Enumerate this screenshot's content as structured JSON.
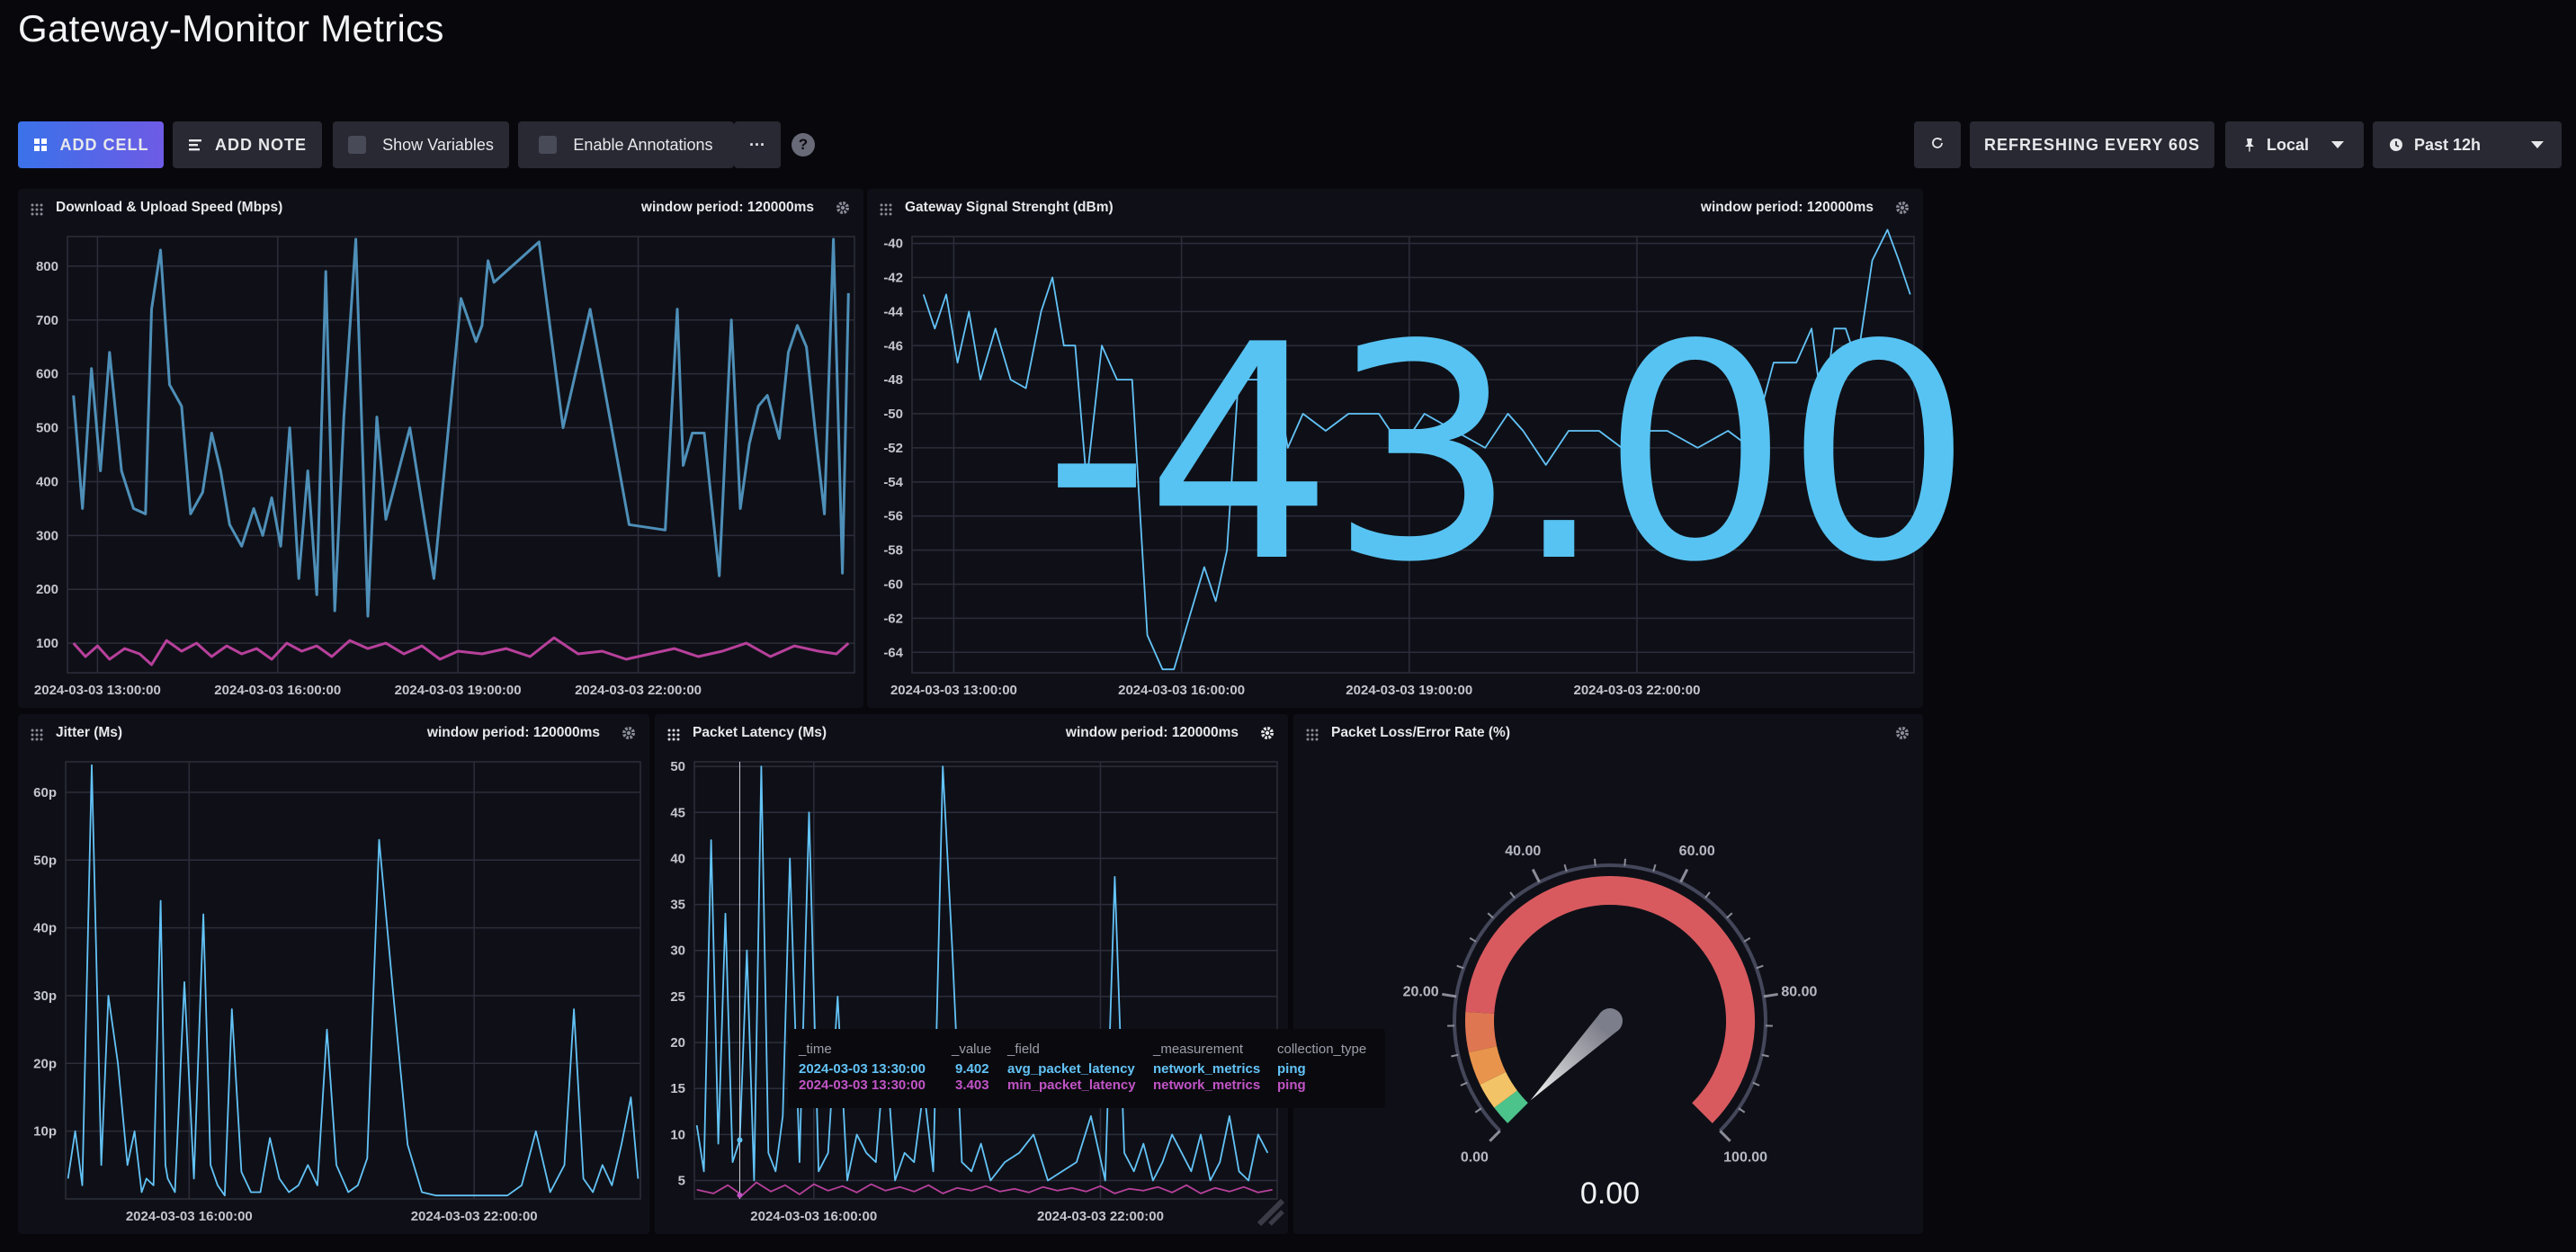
{
  "page_title": "Gateway-Monitor Metrics",
  "toolbar": {
    "add_cell": "ADD CELL",
    "add_note": "ADD NOTE",
    "show_variables": "Show Variables",
    "enable_annotations": "Enable Annotations",
    "more": "···",
    "help": "?",
    "refresh": "REFRESHING EVERY 60S",
    "timezone": "Local",
    "time_range": "Past 12h"
  },
  "panels": {
    "speed": {
      "title": "Download & Upload Speed (Mbps)",
      "window": "window period: 120000ms"
    },
    "signal": {
      "title": "Gateway Signal Strenght (dBm)",
      "window": "window period: 120000ms",
      "big_value": "-43.00"
    },
    "jitter": {
      "title": "Jitter (Ms)",
      "window": "window period: 120000ms"
    },
    "latency": {
      "title": "Packet Latency (Ms)",
      "window": "window period: 120000ms"
    },
    "loss": {
      "title": "Packet Loss/Error Rate (%)",
      "value": "0.00"
    }
  },
  "tooltip": {
    "headers": [
      "_time",
      "_value",
      "_field",
      "_measurement",
      "collection_type"
    ],
    "rows": [
      [
        "2024-03-03 13:30:00",
        "9.402",
        "avg_packet_latency",
        "network_metrics",
        "ping"
      ],
      [
        "2024-03-03 13:30:00",
        "3.403",
        "min_packet_latency",
        "network_metrics",
        "ping"
      ]
    ]
  },
  "colors": {
    "blue": "#4591ed",
    "cyan": "#63c3f7",
    "steel": "#4e8fb8",
    "magenta": "#b7409b",
    "purple": "#c154c6",
    "red": "#d85a5f",
    "orange": "#e8944c",
    "yellow": "#f3c367",
    "green": "#4cc38a"
  },
  "chart_data": [
    {
      "type": "line",
      "title": "Download & Upload Speed (Mbps)",
      "x_ticks": [
        "2024-03-03 13:00:00",
        "2024-03-03 16:00:00",
        "2024-03-03 19:00:00",
        "2024-03-03 22:00:00"
      ],
      "y_ticks": [
        100,
        200,
        300,
        400,
        500,
        600,
        700,
        800
      ],
      "ylim": [
        45,
        855
      ],
      "xlim": [
        11.5,
        24.6
      ],
      "series": [
        {
          "x": [
            11.6,
            11.75,
            11.9,
            12.05,
            12.2,
            12.4,
            12.6,
            12.8,
            12.9,
            13.05,
            13.2,
            13.4,
            13.55,
            13.75,
            13.9,
            14.05,
            14.2,
            14.4,
            14.6,
            14.75,
            14.9,
            15.05,
            15.2,
            15.35,
            15.5,
            15.65,
            15.8,
            15.95,
            16.1,
            16.3,
            16.5,
            16.65,
            16.8,
            17.2,
            17.6,
            18.05,
            18.3,
            18.4,
            18.5,
            18.6,
            19.35,
            19.75,
            20.2,
            20.85,
            21.45,
            21.65,
            21.75,
            21.9,
            22.1,
            22.35,
            22.55,
            22.7,
            22.85,
            23.0,
            23.15,
            23.35,
            23.5,
            23.65,
            23.8,
            23.95,
            24.1,
            24.25,
            24.4,
            24.5
          ],
          "y": [
            560,
            350,
            610,
            420,
            640,
            420,
            350,
            340,
            720,
            830,
            580,
            540,
            340,
            380,
            490,
            420,
            320,
            280,
            350,
            300,
            370,
            280,
            500,
            220,
            420,
            190,
            790,
            160,
            520,
            850,
            150,
            520,
            330,
            500,
            220,
            740,
            660,
            690,
            810,
            770,
            845,
            500,
            720,
            320,
            310,
            720,
            430,
            490,
            490,
            225,
            700,
            350,
            470,
            540,
            560,
            480,
            640,
            690,
            650,
            490,
            340,
            850,
            230,
            750
          ],
          "color": "#4e8fb8"
        },
        {
          "x": [
            11.6,
            11.8,
            12.0,
            12.2,
            12.45,
            12.7,
            12.9,
            13.15,
            13.4,
            13.65,
            13.9,
            14.15,
            14.4,
            14.65,
            14.9,
            15.15,
            15.4,
            15.65,
            15.9,
            16.2,
            16.5,
            16.8,
            17.1,
            17.4,
            17.7,
            18.0,
            18.4,
            18.8,
            19.2,
            19.6,
            20.0,
            20.4,
            20.8,
            21.2,
            21.6,
            22.0,
            22.4,
            22.8,
            23.2,
            23.6,
            24.0,
            24.3,
            24.5
          ],
          "y": [
            100,
            75,
            95,
            70,
            90,
            80,
            60,
            105,
            85,
            100,
            75,
            95,
            80,
            90,
            70,
            100,
            85,
            95,
            75,
            105,
            90,
            100,
            80,
            95,
            70,
            85,
            80,
            90,
            75,
            110,
            80,
            85,
            70,
            80,
            90,
            75,
            85,
            100,
            75,
            95,
            85,
            80,
            100
          ],
          "color": "#b7409b"
        }
      ]
    },
    {
      "type": "line",
      "title": "Gateway Signal Strenght (dBm)",
      "x_ticks": [
        "2024-03-03 13:00:00",
        "2024-03-03 16:00:00",
        "2024-03-03 19:00:00",
        "2024-03-03 22:00:00"
      ],
      "y_ticks": [
        -40,
        -42,
        -44,
        -46,
        -48,
        -50,
        -52,
        -54,
        -56,
        -58,
        -60,
        -62,
        -64
      ],
      "ylim": [
        -65.2,
        -39.6
      ],
      "xlim": [
        11.45,
        24.65
      ],
      "series": [
        {
          "x": [
            11.6,
            11.75,
            11.9,
            12.05,
            12.2,
            12.35,
            12.55,
            12.75,
            12.95,
            13.15,
            13.3,
            13.45,
            13.6,
            13.75,
            13.95,
            14.15,
            14.35,
            14.55,
            14.75,
            14.9,
            15.1,
            15.3,
            15.45,
            15.6,
            15.75,
            16.0,
            16.2,
            16.4,
            16.6,
            16.9,
            17.2,
            17.6,
            17.9,
            18.2,
            18.6,
            19.0,
            19.3,
            19.5,
            19.8,
            20.1,
            20.5,
            20.8,
            21.1,
            21.4,
            21.8,
            22.2,
            22.5,
            22.8,
            23.1,
            23.3,
            23.45,
            23.6,
            23.75,
            23.9,
            24.1,
            24.3,
            24.45,
            24.6
          ],
          "y": [
            -43,
            -45,
            -43,
            -47,
            -44,
            -48,
            -45,
            -48,
            -48.5,
            -44,
            -42,
            -46,
            -46,
            -54,
            -46,
            -48,
            -48,
            -63,
            -65,
            -65,
            -62,
            -59,
            -61,
            -58,
            -48,
            -48,
            -47,
            -52,
            -50,
            -51,
            -50,
            -50,
            -52,
            -50,
            -51,
            -52,
            -50,
            -51,
            -53,
            -51,
            -51,
            -52,
            -51,
            -51,
            -52,
            -51,
            -52,
            -47,
            -47,
            -45,
            -50,
            -45,
            -45,
            -47,
            -41,
            -39.2,
            -41,
            -43
          ],
          "color": "#63c3f7"
        }
      ]
    },
    {
      "type": "line",
      "title": "Jitter (Ms)",
      "x_ticks": [
        "2024-03-03 16:00:00",
        "2024-03-03 22:00:00"
      ],
      "y_ticks": [
        "10p",
        "20p",
        "30p",
        "40p",
        "50p",
        "60p"
      ],
      "y_unit": "p",
      "ylim": [
        0,
        64.5
      ],
      "xlim": [
        12.4,
        24.5
      ],
      "series": [
        {
          "x": [
            12.45,
            12.6,
            12.75,
            12.95,
            13.15,
            13.3,
            13.5,
            13.7,
            13.85,
            14.0,
            14.1,
            14.25,
            14.4,
            14.5,
            14.55,
            14.7,
            14.9,
            15.1,
            15.3,
            15.45,
            15.6,
            15.75,
            15.9,
            16.1,
            16.3,
            16.5,
            16.7,
            16.9,
            17.1,
            17.3,
            17.5,
            17.7,
            17.9,
            18.1,
            18.35,
            18.55,
            18.75,
            19.0,
            19.3,
            19.6,
            19.9,
            20.2,
            20.5,
            20.8,
            21.1,
            21.4,
            21.7,
            22.0,
            22.3,
            22.6,
            22.9,
            23.1,
            23.3,
            23.5,
            23.7,
            23.9,
            24.1,
            24.3,
            24.45
          ],
          "y": [
            3,
            10,
            2,
            64,
            5,
            30,
            20,
            5,
            10,
            1,
            3,
            2,
            44,
            5,
            3,
            1,
            32,
            3,
            42,
            5,
            2,
            0.5,
            28,
            4,
            1,
            1,
            9,
            3,
            1,
            2,
            5,
            2,
            25,
            5,
            1,
            2,
            6,
            53,
            30,
            8,
            1,
            0.5,
            0.5,
            0.5,
            0.5,
            0.5,
            0.5,
            2,
            10,
            1,
            5,
            28,
            3,
            1,
            5,
            2,
            8,
            15,
            3
          ],
          "color": "#63c3f7"
        }
      ]
    },
    {
      "type": "line",
      "title": "Packet Latency (Ms)",
      "x_ticks": [
        "2024-03-03 16:00:00",
        "2024-03-03 22:00:00"
      ],
      "y_ticks": [
        5,
        10,
        15,
        20,
        25,
        30,
        35,
        40,
        45,
        50
      ],
      "ylim": [
        3.0,
        50.5
      ],
      "xlim": [
        12.5,
        24.7
      ],
      "series": [
        {
          "x": [
            12.55,
            12.7,
            12.85,
            13.0,
            13.15,
            13.3,
            13.45,
            13.6,
            13.75,
            13.9,
            14.05,
            14.2,
            14.35,
            14.5,
            14.7,
            14.9,
            15.1,
            15.3,
            15.5,
            15.7,
            15.9,
            16.1,
            16.3,
            16.5,
            16.7,
            16.9,
            17.1,
            17.3,
            17.5,
            17.7,
            17.9,
            18.1,
            18.3,
            18.5,
            18.7,
            19.0,
            19.3,
            19.6,
            19.9,
            20.2,
            20.5,
            20.8,
            21.1,
            21.3,
            21.5,
            21.7,
            21.9,
            22.1,
            22.3,
            22.5,
            22.7,
            22.9,
            23.1,
            23.3,
            23.5,
            23.7,
            23.9,
            24.1,
            24.3,
            24.5
          ],
          "y": [
            11,
            6,
            42,
            9,
            34,
            7,
            9.4,
            30,
            5,
            50,
            8,
            6,
            12,
            40,
            7,
            45,
            6,
            8,
            25,
            5,
            10,
            8,
            7,
            20,
            5,
            8,
            7,
            15,
            6,
            50,
            30,
            7,
            6,
            9,
            5,
            7,
            8,
            10,
            5,
            6,
            7,
            12,
            5,
            38,
            8,
            6,
            9,
            5,
            7,
            10,
            8,
            6,
            10,
            5,
            7,
            12,
            6,
            5,
            10,
            8
          ],
          "color": "#63c3f7"
        },
        {
          "x": [
            12.55,
            12.9,
            13.2,
            13.5,
            13.8,
            14.1,
            14.4,
            14.7,
            15.0,
            15.3,
            15.6,
            15.9,
            16.2,
            16.5,
            16.8,
            17.1,
            17.4,
            17.7,
            18.0,
            18.3,
            18.6,
            18.9,
            19.2,
            19.5,
            19.8,
            20.1,
            20.4,
            20.7,
            21.0,
            21.3,
            21.6,
            21.9,
            22.2,
            22.5,
            22.8,
            23.1,
            23.4,
            23.7,
            24.0,
            24.3,
            24.6
          ],
          "y": [
            4,
            3.6,
            4.5,
            3.4,
            4.8,
            3.8,
            4.5,
            3.5,
            4.6,
            3.9,
            4.4,
            3.7,
            4.6,
            3.9,
            4.3,
            3.8,
            4.5,
            3.6,
            4.2,
            3.9,
            4.4,
            3.8,
            4.1,
            3.7,
            4.3,
            3.9,
            4.2,
            3.8,
            4.4,
            3.6,
            4.1,
            3.9,
            4.3,
            3.7,
            4.5,
            3.6,
            4.2,
            3.8,
            4.3,
            3.7,
            4.0
          ],
          "color": "#b7409b"
        }
      ]
    },
    {
      "type": "gauge",
      "title": "Packet Loss/Error Rate (%)",
      "min": 0,
      "max": 100,
      "tick_labels": [
        "0.00",
        "20.00",
        "40.00",
        "60.00",
        "80.00",
        "100.00"
      ],
      "value": 0.0
    }
  ]
}
